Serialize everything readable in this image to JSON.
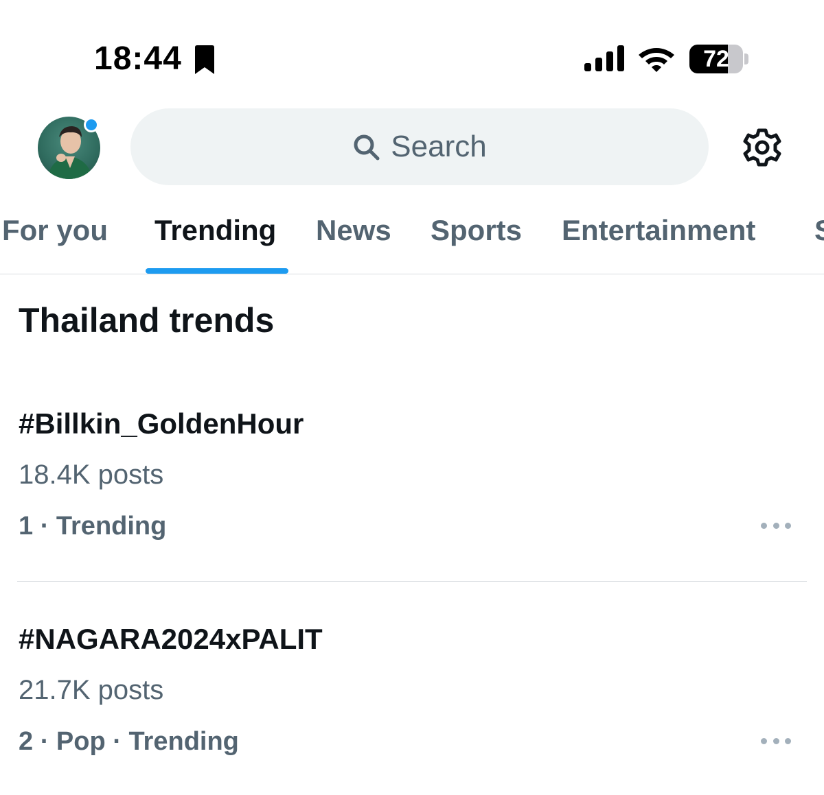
{
  "status_bar": {
    "time": "18:44",
    "battery_percent": 72,
    "battery_label": "72"
  },
  "header": {
    "search_placeholder": "Search",
    "accent_color": "#1d9bf0"
  },
  "tabs": [
    {
      "label": "For you",
      "active": false
    },
    {
      "label": "Trending",
      "active": true
    },
    {
      "label": "News",
      "active": false
    },
    {
      "label": "Sports",
      "active": false
    },
    {
      "label": "Entertainment",
      "active": false
    },
    {
      "label": "S",
      "active": false
    }
  ],
  "section": {
    "title": "Thailand trends"
  },
  "trends": [
    {
      "name": "#Billkin_GoldenHour",
      "posts": "18.4K posts",
      "meta": "1 · Trending"
    },
    {
      "name": "#NAGARA2024xPALIT",
      "posts": "21.7K posts",
      "meta": "2 · Pop · Trending"
    }
  ],
  "icons": {
    "status": [
      "bookmark-icon",
      "signal-icon",
      "wifi-icon",
      "battery-icon"
    ],
    "header": [
      "search-icon",
      "gear-icon"
    ],
    "trend": [
      "more-icon"
    ]
  }
}
